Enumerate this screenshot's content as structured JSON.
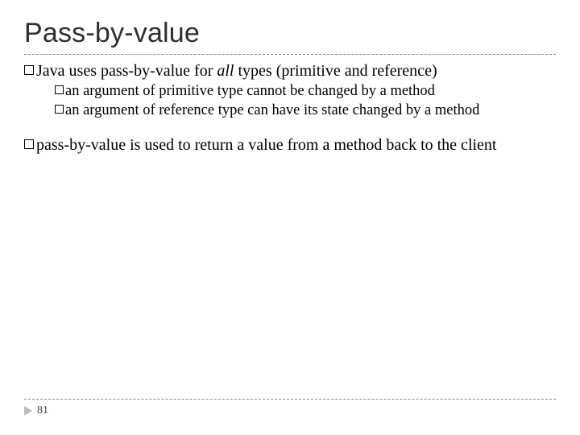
{
  "title": "Pass-by-value",
  "bullets": {
    "b1_pre": "Java uses pass-by-value  for ",
    "b1_em": "all",
    "b1_post": " types (primitive and reference)",
    "b1a": "an argument of primitive type cannot be changed by a method",
    "b1b": "an argument of reference type can have its state changed by a method",
    "b2": "pass-by-value is used to return a value from a method back to the client"
  },
  "page_number": "81"
}
